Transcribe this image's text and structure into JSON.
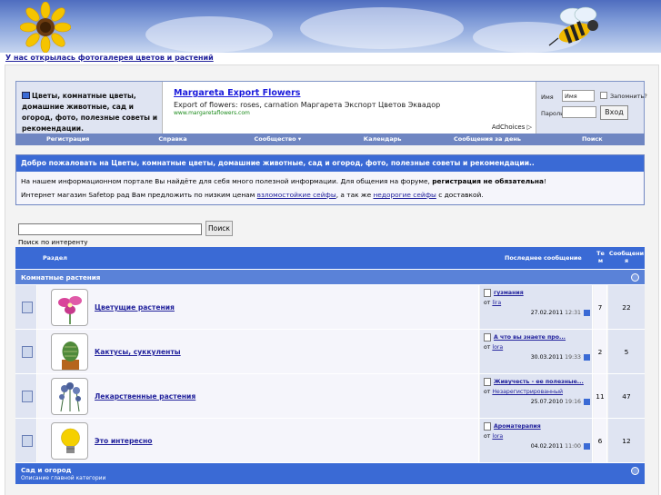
{
  "banner": {
    "notice_link": "У нас открылась фотогалерея цветов и растений"
  },
  "header": {
    "site_title": "Цветы, комнатные цветы, домашние животные, сад и огород, фото, полезные советы и рекомендации.",
    "ad": {
      "title": "Margareta Export Flowers",
      "text": "Export of flowers: roses, carnation Маргарета Экспорт Цветов Эквадор",
      "url": "www.margaretaflowers.com",
      "choices": "AdChoices"
    },
    "login": {
      "username_label": "Имя",
      "username_value": "Имя",
      "remember_label": "Запомнить?",
      "password_label": "Пароль",
      "login_button": "Вход"
    }
  },
  "navbar": [
    "Регистрация",
    "Справка",
    "Сообщество ▾",
    "Календарь",
    "Сообщения за день",
    "Поиск"
  ],
  "welcome": {
    "title": "Добро пожаловать на Цветы, комнатные цветы, домашние животные, сад и огород, фото, полезные советы и рекомендации..",
    "line1_before": "На нашем информационном портале Вы найдёте для себя много полезной информации. Для общения на форуме, ",
    "line1_bold": "регистрация не обязательна",
    "line1_after": "!",
    "line2_before": "Интернет магазин Safetop рад Вам предложить по низким ценам ",
    "line2_link1": "взломостойкие сейфы",
    "line2_mid": ", а так же ",
    "line2_link2": "недорогие сейфы",
    "line2_after": " с доставкой."
  },
  "search": {
    "button": "Поиск",
    "label": "Поиск по интеренту"
  },
  "table": {
    "col_forum": "Раздел",
    "col_last": "Последнее сообщение",
    "col_threads": "Те м",
    "col_posts": "Сообщени я"
  },
  "category1": {
    "title": "Комнатные растения"
  },
  "forums": [
    {
      "name": "Цветущие растения",
      "last_title": "гузмания",
      "last_by_prefix": "от",
      "last_user": "lira",
      "last_date": "27.02.2011",
      "last_time": "12:31",
      "threads": "7",
      "posts": "22",
      "thumb": "flower"
    },
    {
      "name": "Кактусы, суккуленты",
      "last_title": "А что вы знаете про...",
      "last_by_prefix": "от",
      "last_user": "lora",
      "last_date": "30.03.2011",
      "last_time": "19:33",
      "threads": "2",
      "posts": "5",
      "thumb": "cactus"
    },
    {
      "name": "Лекарственные растения",
      "last_title": "Живучесть - ее полезные...",
      "last_by_prefix": "от",
      "last_user": "Незарегистрированный",
      "last_date": "25.07.2010",
      "last_time": "19:16",
      "threads": "11",
      "posts": "47",
      "thumb": "herbs"
    },
    {
      "name": "Это интересно",
      "last_title": "Ароматерапия",
      "last_by_prefix": "от",
      "last_user": "lora",
      "last_date": "04.02.2011",
      "last_time": "11:00",
      "threads": "6",
      "posts": "12",
      "thumb": "lightbulb"
    }
  ],
  "category2": {
    "title": "Сад и огород",
    "description": "Описание главной категории"
  },
  "colors": {
    "accent": "#3a6ad5",
    "nav": "#6f86c2",
    "link": "#22229c"
  }
}
